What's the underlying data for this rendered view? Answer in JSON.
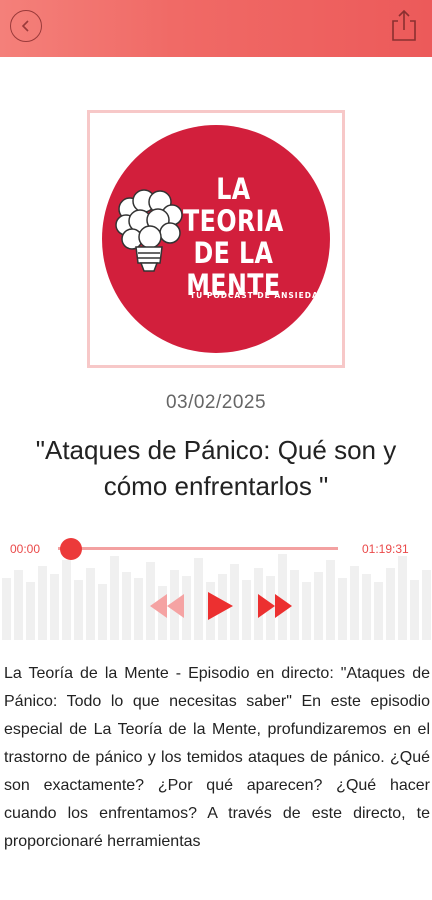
{
  "header": {
    "back_icon": "chevron-left-icon",
    "share_icon": "share-icon",
    "gradient_start": "#f4807a",
    "gradient_end": "#ec5a5a"
  },
  "cover": {
    "title": "LA TEORIA\nDE LA\nMENTE",
    "subtitle": "TU PODCAST DE ANSIEDAD",
    "circle_color": "#d21f3c",
    "icon": "brain-lightbulb-icon"
  },
  "episode": {
    "date": "03/02/2025",
    "title": "\"Ataques de Pánico: Qué son y cómo enfrentarlos \""
  },
  "player": {
    "time_elapsed": "00:00",
    "time_total": "01:19:31",
    "progress": 0,
    "accent": "#ec3a3a",
    "controls": [
      "rewind-icon",
      "play-icon",
      "fast-forward-icon"
    ]
  },
  "description": {
    "text": " La Teoría de la Mente - Episodio en directo: \"Ataques de Pánico: Todo lo que necesitas saber\" En este episodio especial de La Teoría de la Mente, profundizaremos en el trastorno de pánico y los temidos ataques de pánico. ¿Qué son exactamente? ¿Por qué aparecen? ¿Qué hacer cuando los enfrentamos?  A través de este directo, te proporcionaré herramientas"
  }
}
